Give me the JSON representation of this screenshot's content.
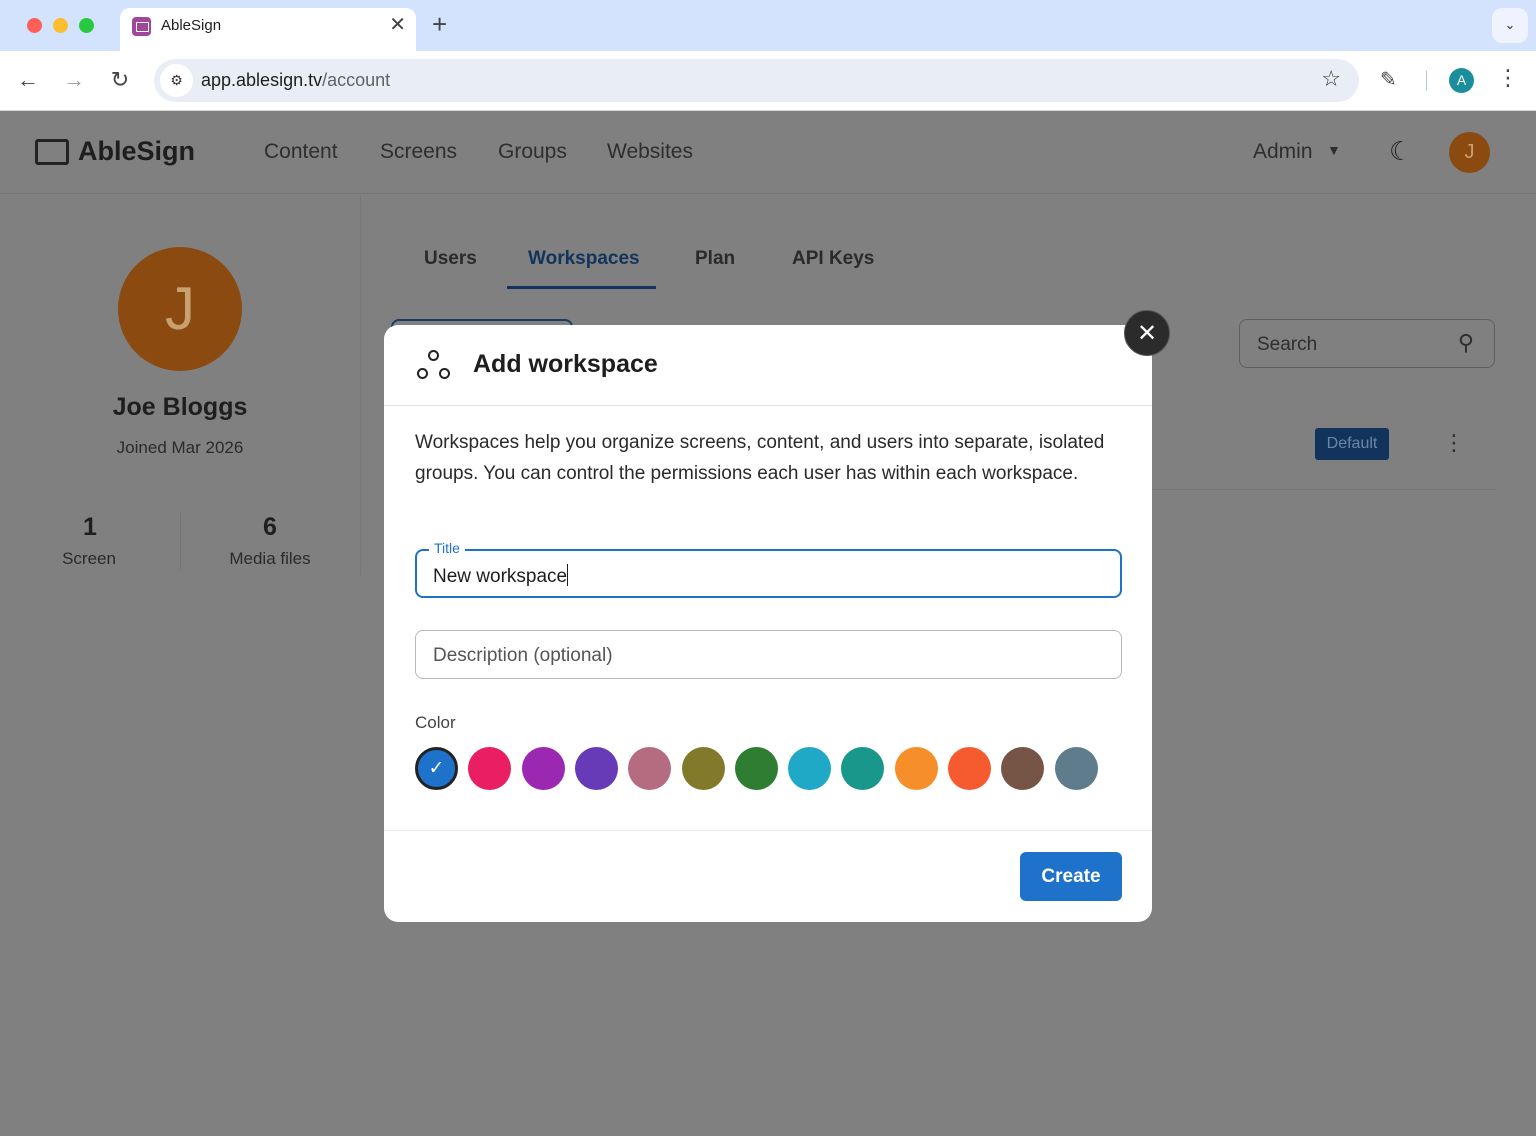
{
  "browser": {
    "tab_title": "AbleSign",
    "tab_close": "✕",
    "new_tab": "+",
    "url_host": "app.ablesign.tv",
    "url_path": "/account",
    "profile_initial": "A"
  },
  "app": {
    "brand": "AbleSign",
    "nav": [
      "Content",
      "Screens",
      "Groups",
      "Websites"
    ],
    "role": "Admin",
    "avatar_initial": "J"
  },
  "profile": {
    "avatar_initial": "J",
    "name": "Joe Bloggs",
    "joined": "Joined Mar 2026",
    "stats": [
      {
        "value": "1",
        "label": "Screen"
      },
      {
        "value": "6",
        "label": "Media files"
      }
    ]
  },
  "account_tabs": {
    "items": [
      "Users",
      "Workspaces",
      "Plan",
      "API Keys"
    ],
    "active": "Workspaces"
  },
  "search": {
    "placeholder": "Search"
  },
  "workspace_row": {
    "badge": "Default"
  },
  "modal": {
    "title": "Add workspace",
    "description": "Workspaces help you organize screens, content, and users into separate, isolated groups. You can control the permissions each user has within each workspace.",
    "title_label": "Title",
    "title_value": "New workspace",
    "description_placeholder": "Description (optional)",
    "color_label": "Color",
    "colors": [
      "#1f72c9",
      "#e91e63",
      "#9c27b0",
      "#673ab7",
      "#b56c80",
      "#827a2a",
      "#2e7d32",
      "#1fa9c6",
      "#18978a",
      "#f68e2a",
      "#f65a2f",
      "#765547",
      "#5f7c8c"
    ],
    "selected_color_index": 0,
    "create_label": "Create"
  }
}
